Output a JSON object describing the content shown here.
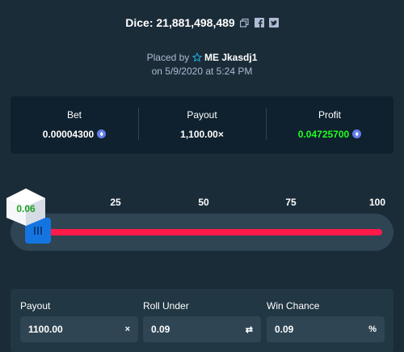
{
  "header": {
    "title": "Dice: 21,881,498,489",
    "icons": [
      "copy-icon",
      "facebook-icon",
      "twitter-icon"
    ]
  },
  "placed": {
    "prefix": "Placed by",
    "user": "ME Jkasdj1",
    "date_line": "on 5/9/2020 at 5:24 PM"
  },
  "stats": {
    "bet_label": "Bet",
    "bet_value": "0.00004300",
    "payout_label": "Payout",
    "payout_value": "1,100.00×",
    "profit_label": "Profit",
    "profit_value": "0.04725700"
  },
  "slider": {
    "ticks": [
      "25",
      "50",
      "75",
      "100"
    ],
    "result": "0.06",
    "level_percent": 0.09
  },
  "controls": {
    "payout_label": "Payout",
    "payout_value": "1100.00",
    "payout_suffix": "×",
    "roll_label": "Roll Under",
    "roll_value": "0.09",
    "roll_suffix": "⇄",
    "win_label": "Win Chance",
    "win_value": "0.09",
    "win_suffix": "%"
  },
  "colors": {
    "background": "#1a2c38",
    "panel": "#0f212e",
    "profit": "#1fff20",
    "slider_red": "#ff1a4a",
    "handle_blue": "#1475e1",
    "result_green": "#1fa31f"
  }
}
